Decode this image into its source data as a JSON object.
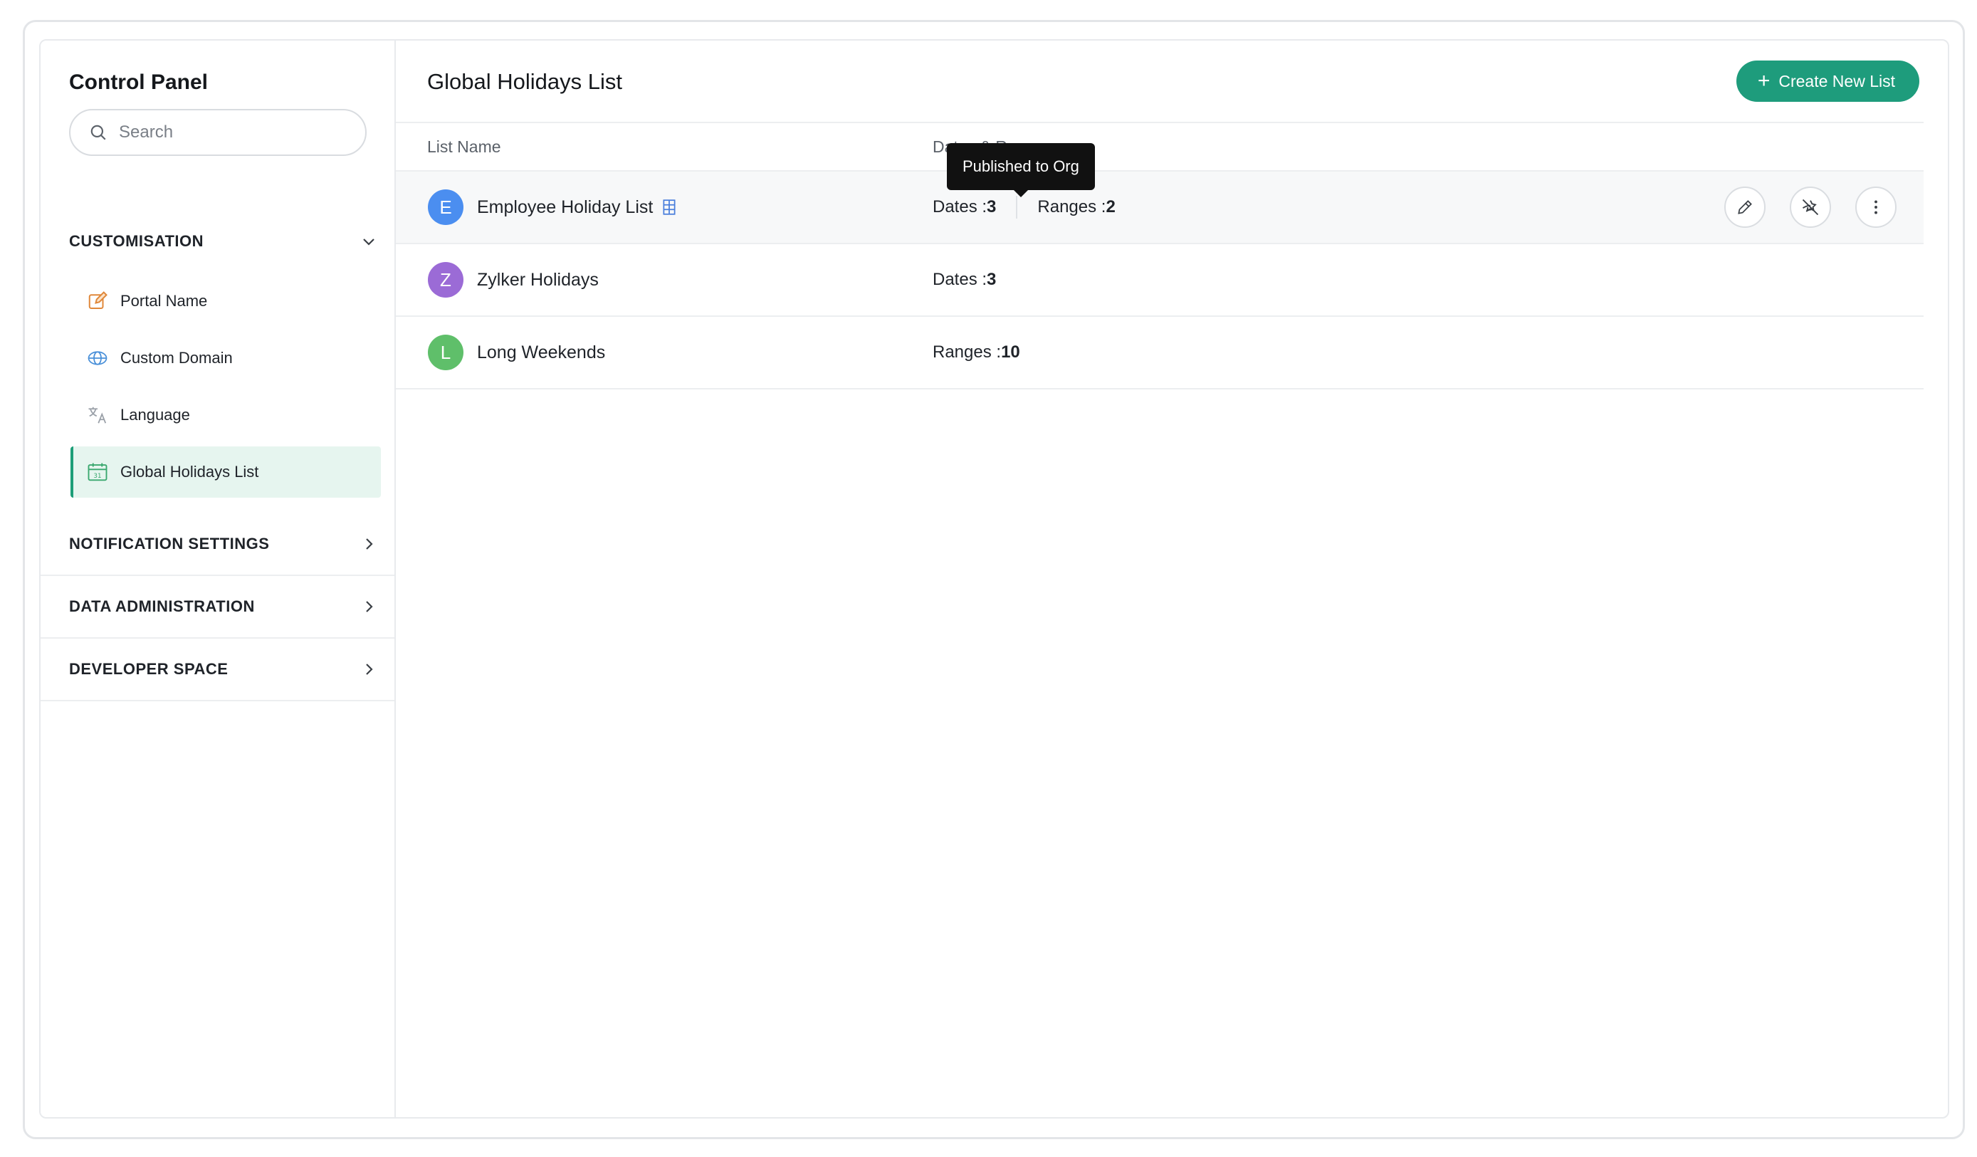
{
  "sidebar": {
    "title": "Control Panel",
    "search_placeholder": "Search",
    "sections": {
      "customisation": {
        "label": "CUSTOMISATION",
        "items": [
          {
            "label": "Portal Name",
            "icon": "edit-square-icon"
          },
          {
            "label": "Custom Domain",
            "icon": "globe-icon"
          },
          {
            "label": "Language",
            "icon": "translate-icon"
          },
          {
            "label": "Global Holidays List",
            "icon": "calendar-icon",
            "active": true
          }
        ]
      },
      "notification": {
        "label": "NOTIFICATION SETTINGS"
      },
      "data_admin": {
        "label": "DATA ADMINISTRATION"
      },
      "developer": {
        "label": "DEVELOPER SPACE"
      }
    }
  },
  "main": {
    "title": "Global Holidays List",
    "create_button": "Create New List",
    "columns": {
      "name": "List Name",
      "dates": "Dates & Ranges"
    },
    "tooltip": "Published to Org",
    "rows": [
      {
        "initial": "E",
        "name": "Employee Holiday List",
        "dates_label": "Dates : ",
        "dates": "3",
        "ranges_label": "Ranges : ",
        "ranges": "2",
        "avatar_color": "#4b8ef0"
      },
      {
        "initial": "Z",
        "name": "Zylker Holidays",
        "dates_label": "Dates : ",
        "dates": "3",
        "avatar_color": "#9b6bd6"
      },
      {
        "initial": "L",
        "name": "Long Weekends",
        "ranges_label": "Ranges : ",
        "ranges": "10",
        "avatar_color": "#5fbf6a"
      }
    ]
  },
  "colors": {
    "accent": "#1e9c7c",
    "active_bg": "#e6f5ef"
  }
}
